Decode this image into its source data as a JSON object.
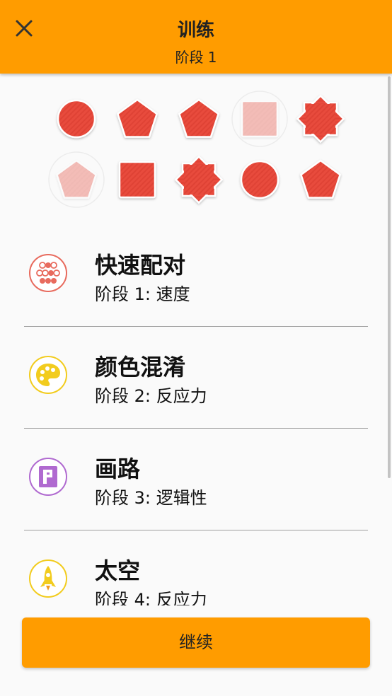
{
  "header": {
    "title": "训练",
    "subtitle": "阶段 1",
    "close_icon": "close-icon",
    "background": "#ff9c00"
  },
  "shapes": [
    {
      "kind": "circle",
      "state": "normal"
    },
    {
      "kind": "pentagon",
      "state": "normal"
    },
    {
      "kind": "pentagon",
      "state": "normal"
    },
    {
      "kind": "square",
      "state": "faded"
    },
    {
      "kind": "octagram",
      "state": "normal"
    },
    {
      "kind": "pentagon",
      "state": "faded"
    },
    {
      "kind": "square",
      "state": "normal"
    },
    {
      "kind": "octagram",
      "state": "normal"
    },
    {
      "kind": "circle",
      "state": "normal"
    },
    {
      "kind": "pentagon",
      "state": "normal"
    }
  ],
  "shape_color": "#e84c3d",
  "games": [
    {
      "title": "快速配对",
      "subtitle": "阶段 1: 速度",
      "icon": "dots-grid-icon",
      "color": "#e86b5e"
    },
    {
      "title": "颜色混淆",
      "subtitle": "阶段 2: 反应力",
      "icon": "palette-icon",
      "color": "#f2cc1e"
    },
    {
      "title": "画路",
      "subtitle": "阶段 3: 逻辑性",
      "icon": "path-p-icon",
      "color": "#b06ad0"
    },
    {
      "title": "太空",
      "subtitle": "阶段 4: 反应力",
      "icon": "rocket-icon",
      "color": "#f2cc1e"
    }
  ],
  "continue_label": "继续"
}
